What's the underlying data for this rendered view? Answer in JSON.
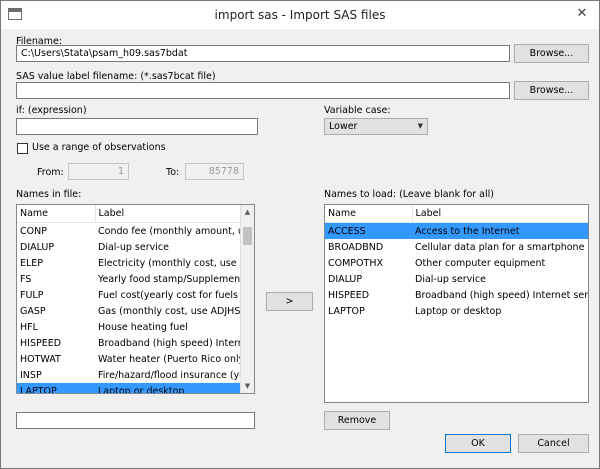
{
  "window": {
    "title": "import sas - Import SAS files",
    "close_glyph": "✕"
  },
  "filename": {
    "label": "Filename:",
    "value": "C:\\Users\\Stata\\psam_h09.sas7bdat",
    "browse": "Browse..."
  },
  "value_label": {
    "label": "SAS value label filename: (*.sas7bcat file)",
    "value": "",
    "browse": "Browse..."
  },
  "if_expr": {
    "label": "if: (expression)",
    "value": ""
  },
  "variable_case": {
    "label": "Variable case:",
    "selected": "Lower"
  },
  "range": {
    "label": "Use a range of observations",
    "checked": false,
    "from_label": "From:",
    "from_value": "1",
    "to_label": "To:",
    "to_value": "85778"
  },
  "names_in_file": {
    "label": "Names in file:",
    "columns": [
      "Name",
      "Label"
    ],
    "rows": [
      {
        "name": "CONP",
        "label": "Condo fee (monthly amount, use"
      },
      {
        "name": "DIALUP",
        "label": "Dial-up service"
      },
      {
        "name": "ELEP",
        "label": "Electricity (monthly cost, use ADJ"
      },
      {
        "name": "FS",
        "label": "Yearly food stamp/Supplemental"
      },
      {
        "name": "FULP",
        "label": "Fuel cost(yearly cost for fuels oth"
      },
      {
        "name": "GASP",
        "label": "Gas (monthly cost, use ADJHSG t"
      },
      {
        "name": "HFL",
        "label": "House heating fuel"
      },
      {
        "name": "HISPEED",
        "label": "Broadband (high speed) Internet"
      },
      {
        "name": "HOTWAT",
        "label": "Water heater (Puerto Rico only)"
      },
      {
        "name": "INSP",
        "label": "Fire/hazard/flood insurance (year"
      },
      {
        "name": "LAPTOP",
        "label": "Laptop or desktop",
        "selected": true
      }
    ],
    "search_value": ""
  },
  "move_button": ">",
  "names_to_load": {
    "label": "Names to load: (Leave blank for all)",
    "columns": [
      "Name",
      "Label"
    ],
    "rows": [
      {
        "name": "ACCESS",
        "label": "Access to the Internet",
        "selected": true
      },
      {
        "name": "BROADBND",
        "label": "Cellular data plan for a smartphone o..."
      },
      {
        "name": "COMPOTHX",
        "label": "Other computer equipment"
      },
      {
        "name": "DIALUP",
        "label": "Dial-up service"
      },
      {
        "name": "HISPEED",
        "label": "Broadband (high speed) Internet servi..."
      },
      {
        "name": "LAPTOP",
        "label": "Laptop or desktop"
      }
    ],
    "remove": "Remove"
  },
  "actions": {
    "ok": "OK",
    "cancel": "Cancel"
  },
  "colors": {
    "selection": "#3399ff",
    "dialog_bg": "#f0f0f0",
    "default_button_border": "#0078d7"
  }
}
